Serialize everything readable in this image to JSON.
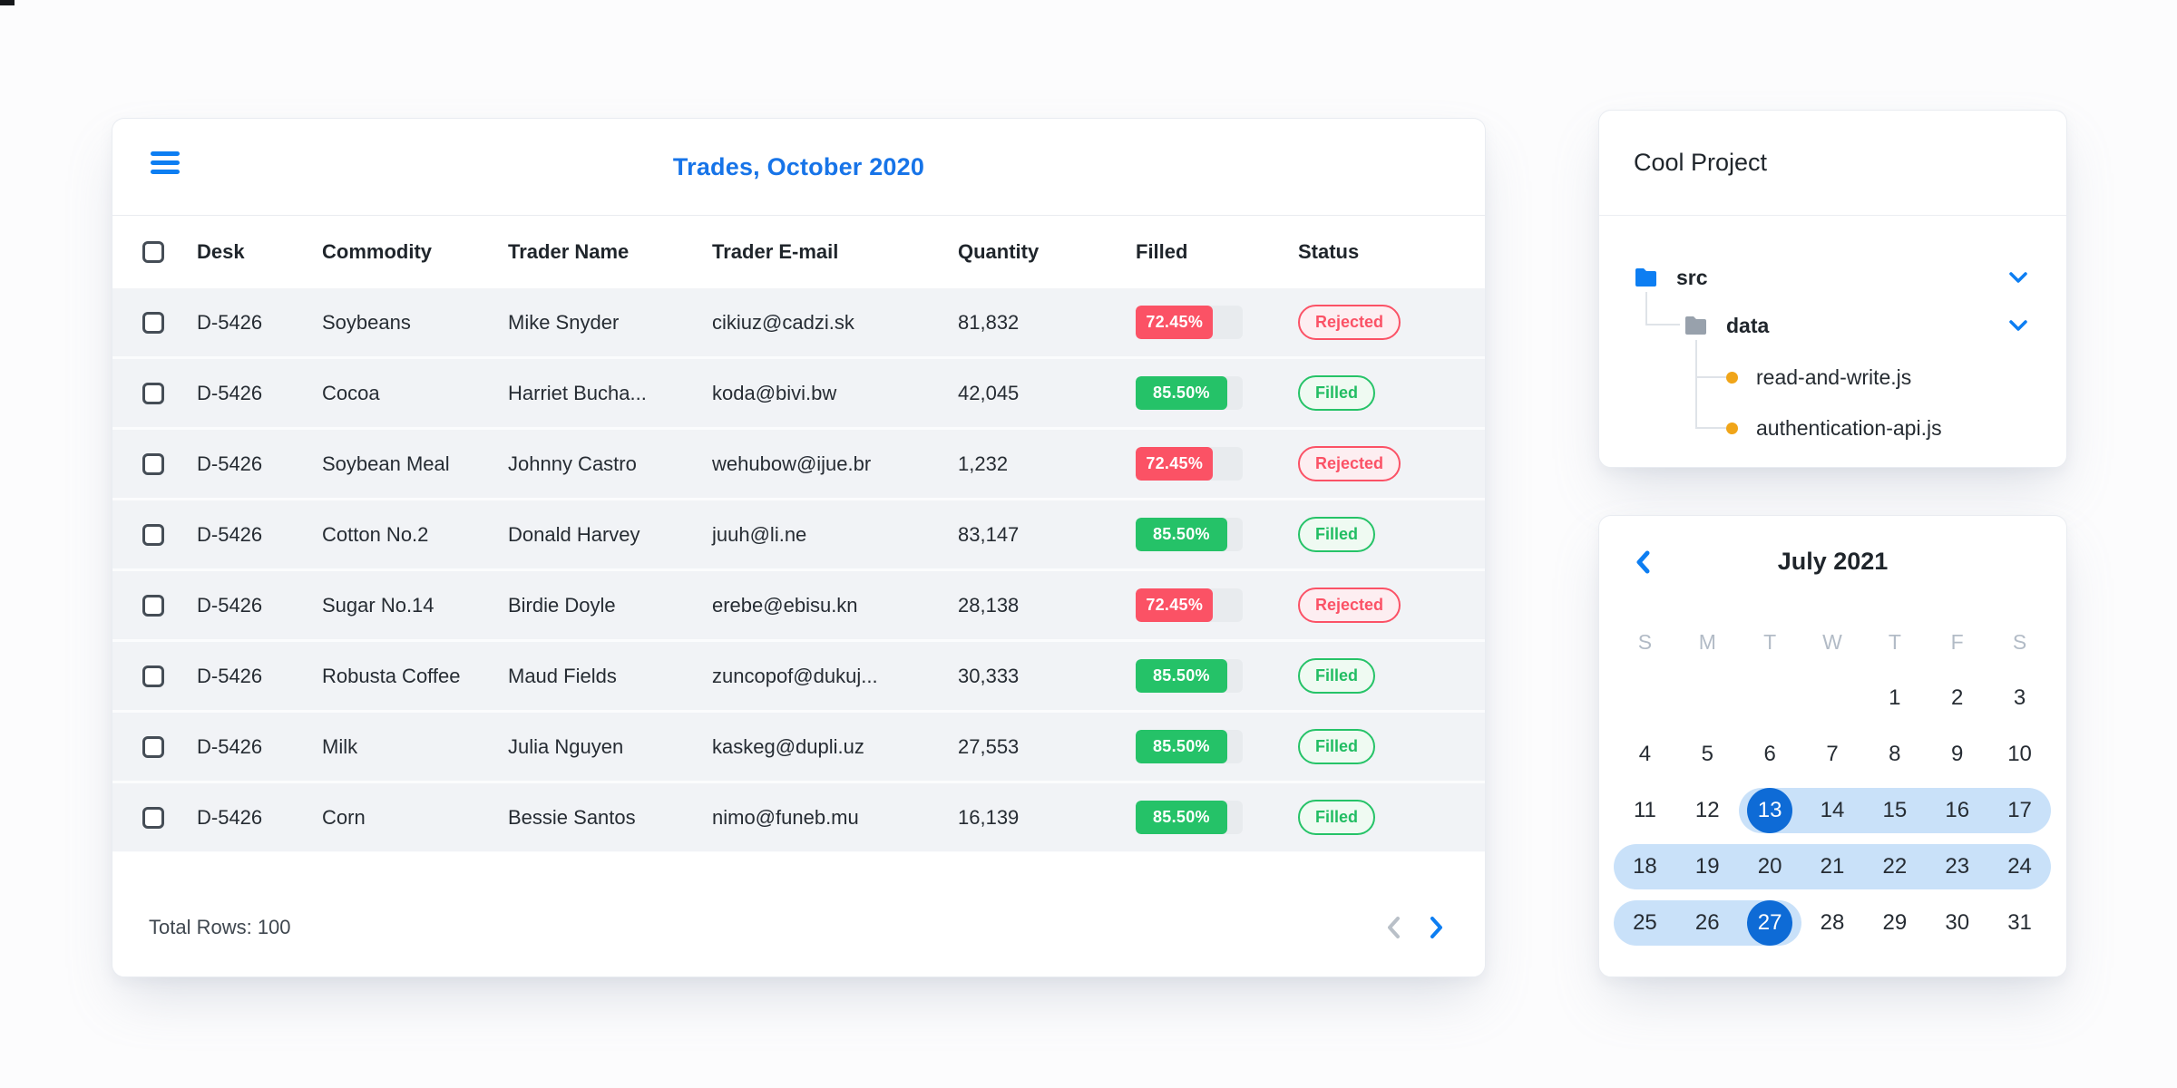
{
  "colors": {
    "accent_blue": "#0d7ef2",
    "title_blue": "#1774e8",
    "calendar_selected": "#0e6bd6",
    "calendar_range": "#c9e1f9",
    "danger_red": "#fb5265",
    "success_green": "#25c268",
    "file_dot_orange": "#f0a519"
  },
  "table_card": {
    "title": "Trades, October 2020",
    "columns": [
      "Desk",
      "Commodity",
      "Trader Name",
      "Trader E-mail",
      "Quantity",
      "Filled",
      "Status"
    ],
    "rows": [
      {
        "desk": "D-5426",
        "commodity": "Soybeans",
        "trader_name": "Mike Snyder",
        "trader_email": "cikiuz@cadzi.sk",
        "quantity": "81,832",
        "filled_label": "72.45%",
        "filled_value": 72.45,
        "status": "Rejected",
        "variant": "danger"
      },
      {
        "desk": "D-5426",
        "commodity": "Cocoa",
        "trader_name": "Harriet Bucha...",
        "trader_email": "koda@bivi.bw",
        "quantity": "42,045",
        "filled_label": "85.50%",
        "filled_value": 85.5,
        "status": "Filled",
        "variant": "success"
      },
      {
        "desk": "D-5426",
        "commodity": "Soybean Meal",
        "trader_name": "Johnny Castro",
        "trader_email": "wehubow@ijue.br",
        "quantity": "1,232",
        "filled_label": "72.45%",
        "filled_value": 72.45,
        "status": "Rejected",
        "variant": "danger"
      },
      {
        "desk": "D-5426",
        "commodity": "Cotton No.2",
        "trader_name": "Donald Harvey",
        "trader_email": "juuh@li.ne",
        "quantity": "83,147",
        "filled_label": "85.50%",
        "filled_value": 85.5,
        "status": "Filled",
        "variant": "success"
      },
      {
        "desk": "D-5426",
        "commodity": "Sugar No.14",
        "trader_name": "Birdie Doyle",
        "trader_email": "erebe@ebisu.kn",
        "quantity": "28,138",
        "filled_label": "72.45%",
        "filled_value": 72.45,
        "status": "Rejected",
        "variant": "danger"
      },
      {
        "desk": "D-5426",
        "commodity": "Robusta Coffee",
        "trader_name": "Maud Fields",
        "trader_email": "zuncopof@dukuj...",
        "quantity": "30,333",
        "filled_label": "85.50%",
        "filled_value": 85.5,
        "status": "Filled",
        "variant": "success"
      },
      {
        "desk": "D-5426",
        "commodity": "Milk",
        "trader_name": "Julia Nguyen",
        "trader_email": "kaskeg@dupli.uz",
        "quantity": "27,553",
        "filled_label": "85.50%",
        "filled_value": 85.5,
        "status": "Filled",
        "variant": "success"
      },
      {
        "desk": "D-5426",
        "commodity": "Corn",
        "trader_name": "Bessie Santos",
        "trader_email": "nimo@funeb.mu",
        "quantity": "16,139",
        "filled_label": "85.50%",
        "filled_value": 85.5,
        "status": "Filled",
        "variant": "success"
      }
    ],
    "footer": {
      "total_label": "Total Rows: 100"
    }
  },
  "project_card": {
    "title": "Cool Project",
    "tree": {
      "folder_src": "src",
      "folder_data": "data",
      "file_1": "read-and-write.js",
      "file_2": "authentication-api.js"
    }
  },
  "calendar_card": {
    "title": "July 2021",
    "weekdays": [
      "S",
      "M",
      "T",
      "W",
      "T",
      "F",
      "S"
    ],
    "weeks": [
      [
        null,
        null,
        null,
        null,
        {
          "d": "1"
        },
        {
          "d": "2"
        },
        {
          "d": "3"
        }
      ],
      [
        {
          "d": "4"
        },
        {
          "d": "5"
        },
        {
          "d": "6"
        },
        {
          "d": "7"
        },
        {
          "d": "8"
        },
        {
          "d": "9"
        },
        {
          "d": "10"
        }
      ],
      [
        {
          "d": "11"
        },
        {
          "d": "12"
        },
        {
          "d": "13",
          "selected": true,
          "range": true,
          "round": "left"
        },
        {
          "d": "14",
          "range": true
        },
        {
          "d": "15",
          "range": true
        },
        {
          "d": "16",
          "range": true
        },
        {
          "d": "17",
          "range": true,
          "round": "right"
        }
      ],
      [
        {
          "d": "18",
          "range": true,
          "round": "left"
        },
        {
          "d": "19",
          "range": true
        },
        {
          "d": "20",
          "range": true
        },
        {
          "d": "21",
          "range": true
        },
        {
          "d": "22",
          "range": true
        },
        {
          "d": "23",
          "range": true
        },
        {
          "d": "24",
          "range": true,
          "round": "right"
        }
      ],
      [
        {
          "d": "25",
          "range": true,
          "round": "left"
        },
        {
          "d": "26",
          "range": true
        },
        {
          "d": "27",
          "selected": true,
          "range": true,
          "round": "right"
        },
        {
          "d": "28"
        },
        {
          "d": "29"
        },
        {
          "d": "30"
        },
        {
          "d": "31"
        }
      ]
    ]
  }
}
